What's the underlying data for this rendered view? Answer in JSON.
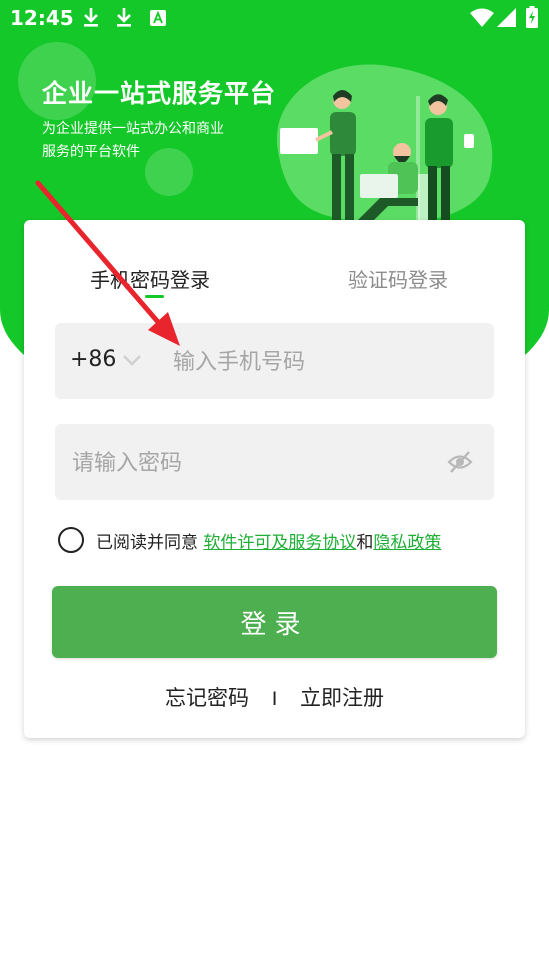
{
  "status_bar": {
    "time": "12:45",
    "icons": [
      "download-icon",
      "download-icon",
      "font-a-icon",
      "wifi-icon",
      "signal-icon",
      "battery-charging-icon"
    ]
  },
  "hero": {
    "title": "企业一站式服务平台",
    "subtitle": "为企业提供一站式办公和商业服务的平台软件"
  },
  "login": {
    "tabs": [
      {
        "label": "手机密码登录",
        "active": true
      },
      {
        "label": "验证码登录",
        "active": false
      }
    ],
    "country_code": "+86",
    "phone_placeholder": "输入手机号码",
    "password_placeholder": "请输入密码",
    "agreement_prefix": "已阅读并同意 ",
    "agreement_link1": "软件许可及服务协议",
    "agreement_and": "和",
    "agreement_link2": "隐私政策",
    "login_button": "登录",
    "forgot_password": "忘记密码",
    "separator": "I",
    "register": "立即注册"
  },
  "colors": {
    "brand_green": "#15c829",
    "button_green": "#4daf4f",
    "link_green": "#1fae35",
    "annotation_arrow": "#e8252d"
  }
}
